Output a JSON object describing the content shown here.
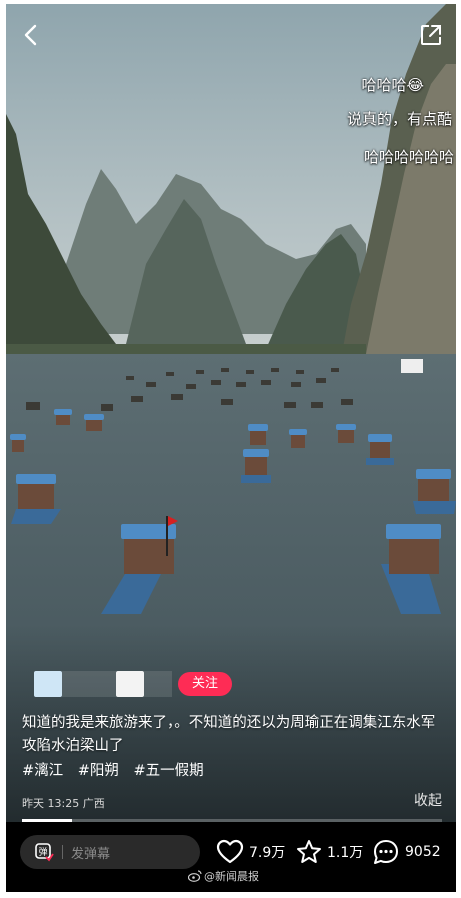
{
  "top": {
    "back_icon": "chevron-left-icon",
    "share_icon": "share-out-icon"
  },
  "danmu": {
    "comment_1": "哈哈哈😂",
    "comment_2": "说真的，有点酷",
    "comment_3": "哈哈哈哈哈哈"
  },
  "author": {
    "follow_label": "关注"
  },
  "caption": {
    "text": "知道的我是来旅游来了，。不知道的还以为周瑜正在调集江东水军攻陷水泊梁山了"
  },
  "hashtags": [
    "#漓江",
    "#阳朔",
    "#五一假期"
  ],
  "meta": {
    "time": "昨天 13:25",
    "location": "广西"
  },
  "collapse_label": "收起",
  "progress": {
    "fraction": 0.12
  },
  "bottom": {
    "danmaku_placeholder": "发弹幕",
    "likes": "7.9万",
    "favorites": "1.1万",
    "comments": "9052"
  },
  "watermark": "@新闻晨报",
  "colors": {
    "accent": "#fe2c55"
  }
}
